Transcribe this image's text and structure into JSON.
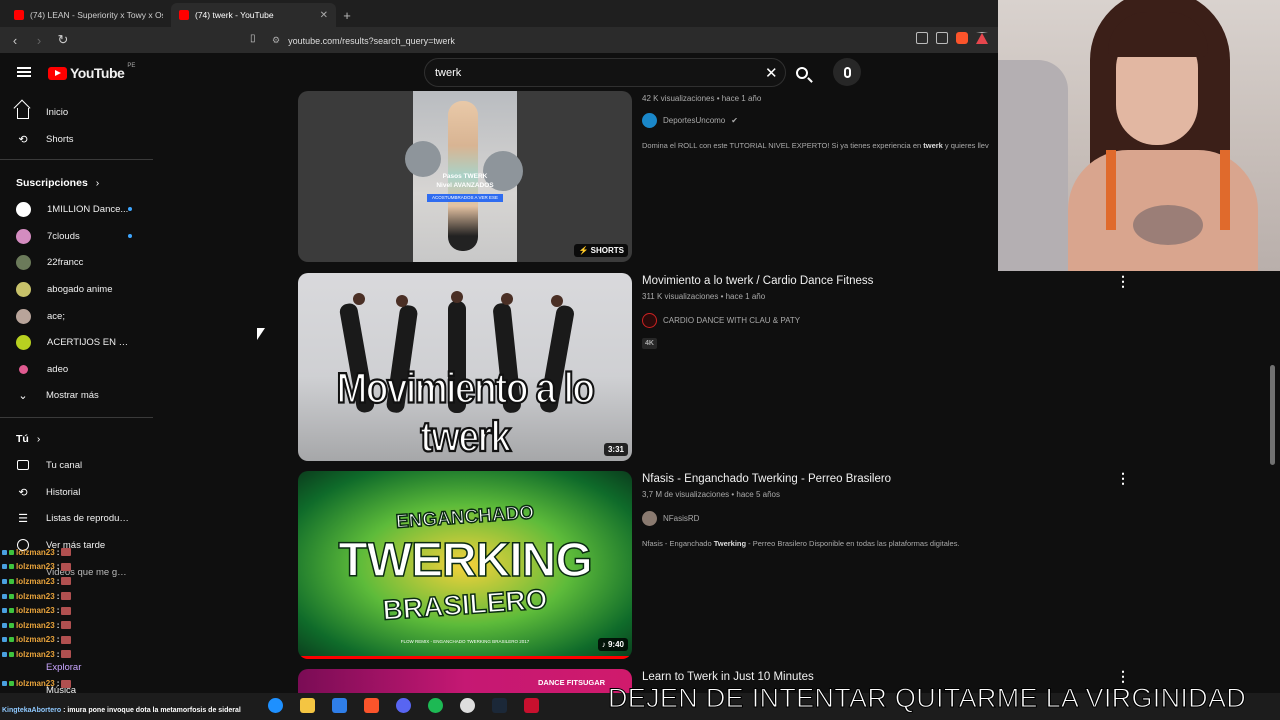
{
  "browser": {
    "tabs": [
      {
        "title": "(74) LEAN - Superiority x Towy x Osq",
        "active": false
      },
      {
        "title": "(74) twerk - YouTube",
        "active": true
      }
    ],
    "url": "youtube.com/results?search_query=twerk"
  },
  "header": {
    "logo": "YouTube",
    "country": "PE",
    "search_value": "twerk"
  },
  "sidebar": {
    "main": [
      {
        "label": "Inicio",
        "icon": "home-icon"
      },
      {
        "label": "Shorts",
        "icon": "shorts-icon"
      }
    ],
    "subs_heading": "Suscripciones",
    "subs": [
      {
        "label": "1MILLION Dance...",
        "color": "#ffffff",
        "new": true
      },
      {
        "label": "7clouds",
        "color": "#d48cc0",
        "new": true
      },
      {
        "label": "22francc",
        "color": "#6b7a5a",
        "new": false
      },
      {
        "label": "abogado anime",
        "color": "#c8c26a",
        "new": false
      },
      {
        "label": "ace;",
        "color": "#b8a49a",
        "new": false
      },
      {
        "label": "ACERTIJOS EN 7 S...",
        "color": "#b8d020",
        "new": false
      },
      {
        "label": "adeo",
        "color": "#e05a90",
        "new": false
      }
    ],
    "show_more": "Mostrar más",
    "you_heading": "Tú",
    "you_items": [
      {
        "label": "Tu canal",
        "icon": "channel-icon"
      },
      {
        "label": "Historial",
        "icon": "history-icon"
      },
      {
        "label": "Listas de reproducc...",
        "icon": "playlist-icon"
      },
      {
        "label": "Ver más tarde",
        "icon": "clock-icon"
      },
      {
        "label": "Videos que me gus...",
        "icon": "like-icon"
      }
    ],
    "explore": "Explorar",
    "music": "Música"
  },
  "chat": {
    "username": "lolzman23",
    "lines": 11,
    "ticker_user": "KingtekaAbortero",
    "ticker_text": "imura pone invoque dota la metamorfosis de sideral"
  },
  "results": [
    {
      "title": "",
      "views": "42 K visualizaciones",
      "age": "hace 1 año",
      "channel": "DeportesUncomo",
      "verified": true,
      "desc_pre": "Domina el ROLL con este TUTORIAL NIVEL EXPERTO! Si ya tienes experiencia en ",
      "desc_bold": "twerk",
      "desc_post": " y quieres llev",
      "badge": "SHORTS",
      "thumb_caption_1": "Pasos TWERK",
      "thumb_caption_2": "Nivel AVANZADOS",
      "thumb_caption_3": "ACOSTUMBRADOS A VER ESE"
    },
    {
      "title": "Movimiento a lo twerk / Cardio Dance Fitness",
      "views": "311 K visualizaciones",
      "age": "hace 1 año",
      "channel": "CARDIO DANCE WITH CLAU & PATY",
      "tag": "4K",
      "duration": "3:31",
      "thumb_text": "Movimiento a lo twerk"
    },
    {
      "title": "Nfasis - Enganchado Twerking - Perreo Brasilero",
      "views": "3,7 M de visualizaciones",
      "age": "hace 5 años",
      "channel": "NFasisRD",
      "desc_pre": "Nfasis - Enganchado ",
      "desc_bold": "Twerking",
      "desc_post": " - Perreo Brasilero Disponible en todas las plataformas digitales.",
      "duration": "9:40",
      "thumb_line1": "ENGANCHADO",
      "thumb_line2": "TWERKING",
      "thumb_line3": "BRASILERO",
      "thumb_small": "FLOW REMIX - ENGANCHADO TWERKING BRASILERO 2017"
    },
    {
      "title": "Learn to Twerk in Just 10 Minutes",
      "thumb_text": "DANCE FITSUGAR"
    }
  ],
  "overlay": {
    "subtitle": "DEJEN DE INTENTAR QUITARME LA VIRGINIDAD"
  },
  "colors": {
    "accent": "#ff0000",
    "bg": "#0f0f0f",
    "link_blue": "#3ea6ff"
  }
}
